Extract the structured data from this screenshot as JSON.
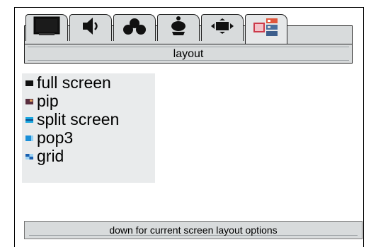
{
  "tabs": [
    {
      "icon": "tv-screen-icon",
      "active": false
    },
    {
      "icon": "speaker-icon",
      "active": false
    },
    {
      "icon": "cluster-icon",
      "active": false
    },
    {
      "icon": "satellite-dish-icon",
      "active": false
    },
    {
      "icon": "display-arrows-icon",
      "active": false
    },
    {
      "icon": "layout-thumbnails-icon",
      "active": true
    }
  ],
  "section": {
    "title": "layout"
  },
  "layouts": [
    {
      "label": "full screen",
      "icon": "full-screen-icon",
      "color": "#111111"
    },
    {
      "label": "pip",
      "icon": "pip-icon",
      "color": "#5a2f3f"
    },
    {
      "label": "split screen",
      "icon": "split-screen-icon",
      "color": "#1aa7e0"
    },
    {
      "label": "pop3",
      "icon": "pop3-icon",
      "color": "#1a8fd8"
    },
    {
      "label": "grid",
      "icon": "grid-icon",
      "color": "#1a5fb0"
    }
  ],
  "footer": {
    "text": "down for current screen layout options"
  },
  "colors": {
    "panel_bg": "#d8dbdc",
    "list_bg": "#e9ebec"
  }
}
